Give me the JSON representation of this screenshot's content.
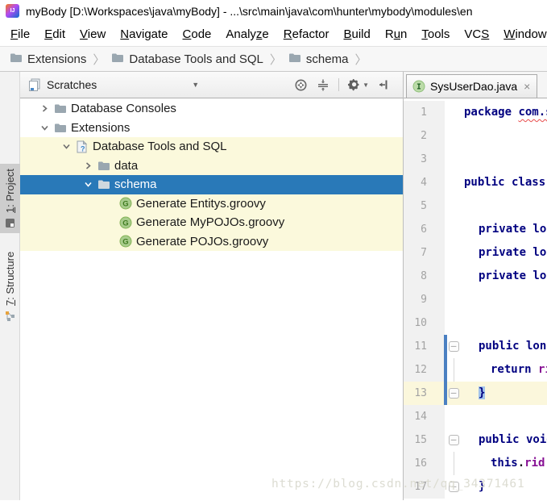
{
  "title_bar": {
    "title": "myBody [D:\\Workspaces\\java\\myBody] - ...\\src\\main\\java\\com\\hunter\\mybody\\modules\\en"
  },
  "menu_bar": {
    "items": [
      {
        "pre": "",
        "key": "F",
        "post": "ile"
      },
      {
        "pre": "",
        "key": "E",
        "post": "dit"
      },
      {
        "pre": "",
        "key": "V",
        "post": "iew"
      },
      {
        "pre": "",
        "key": "N",
        "post": "avigate"
      },
      {
        "pre": "",
        "key": "C",
        "post": "ode"
      },
      {
        "pre": "Analy",
        "key": "z",
        "post": "e"
      },
      {
        "pre": "",
        "key": "R",
        "post": "efactor"
      },
      {
        "pre": "",
        "key": "B",
        "post": "uild"
      },
      {
        "pre": "R",
        "key": "u",
        "post": "n"
      },
      {
        "pre": "",
        "key": "T",
        "post": "ools"
      },
      {
        "pre": "VC",
        "key": "S",
        "post": ""
      },
      {
        "pre": "",
        "key": "W",
        "post": "indow"
      }
    ]
  },
  "breadcrumbs": {
    "items": [
      {
        "label": "Extensions"
      },
      {
        "label": "Database Tools and SQL"
      },
      {
        "label": "schema"
      }
    ]
  },
  "tool_window_bar": {
    "buttons": [
      {
        "pre": "",
        "key": "1",
        "post": ": Project",
        "icon": "project-icon",
        "active": true
      },
      {
        "pre": "",
        "key": "7",
        "post": ": Structure",
        "icon": "structure-icon",
        "active": false
      }
    ]
  },
  "project_panel": {
    "header": {
      "title": "Scratches",
      "icons": [
        "locate-icon",
        "collapse-all-icon",
        "settings-icon",
        "hide-icon"
      ]
    },
    "tree": [
      {
        "label": "Database Consoles",
        "depth": 0,
        "chevron": "collapsed",
        "icon": "folder",
        "bg": "none"
      },
      {
        "label": "Extensions",
        "depth": 0,
        "chevron": "expanded",
        "icon": "folder",
        "bg": "none"
      },
      {
        "label": "Database Tools and SQL",
        "depth": 1,
        "chevron": "expanded",
        "icon": "unknown-file",
        "bg": "yellow"
      },
      {
        "label": "data",
        "depth": 2,
        "chevron": "collapsed",
        "icon": "folder",
        "bg": "yellow"
      },
      {
        "label": "schema",
        "depth": 2,
        "chevron": "expanded",
        "icon": "folder",
        "bg": "selected"
      },
      {
        "label": "Generate Entitys.groovy",
        "depth": 3,
        "chevron": "none",
        "icon": "groovy",
        "bg": "yellow"
      },
      {
        "label": "Generate MyPOJOs.groovy",
        "depth": 3,
        "chevron": "none",
        "icon": "groovy",
        "bg": "yellow"
      },
      {
        "label": "Generate POJOs.groovy",
        "depth": 3,
        "chevron": "none",
        "icon": "groovy",
        "bg": "yellow"
      }
    ]
  },
  "editor": {
    "tab": {
      "title": "SysUserDao.java",
      "icon": "interface-icon",
      "close": "×"
    },
    "lines": [
      {
        "num": 1,
        "indent": 0,
        "segments": [
          {
            "t": "package ",
            "c": "kw"
          },
          {
            "t": "com.s",
            "c": "err"
          }
        ]
      },
      {
        "num": 2,
        "indent": 0,
        "segments": []
      },
      {
        "num": 3,
        "indent": 0,
        "segments": []
      },
      {
        "num": 4,
        "indent": 0,
        "segments": [
          {
            "t": "public class ",
            "c": "kw"
          }
        ]
      },
      {
        "num": 5,
        "indent": 0,
        "segments": []
      },
      {
        "num": 6,
        "indent": 1,
        "segments": [
          {
            "t": "private lon",
            "c": "kw"
          }
        ]
      },
      {
        "num": 7,
        "indent": 1,
        "segments": [
          {
            "t": "private lon",
            "c": "kw"
          }
        ]
      },
      {
        "num": 8,
        "indent": 1,
        "segments": [
          {
            "t": "private lon",
            "c": "kw"
          }
        ]
      },
      {
        "num": 9,
        "indent": 0,
        "segments": []
      },
      {
        "num": 10,
        "indent": 0,
        "segments": []
      },
      {
        "num": 11,
        "indent": 1,
        "fold": "start",
        "vcs": true,
        "segments": [
          {
            "t": "public long",
            "c": "kw"
          }
        ]
      },
      {
        "num": 12,
        "indent": 2,
        "foldline": true,
        "vcs": true,
        "segments": [
          {
            "t": "return ",
            "c": "kw"
          },
          {
            "t": "ri",
            "c": "field"
          }
        ]
      },
      {
        "num": 13,
        "indent": 1,
        "fold": "end",
        "vcs": true,
        "current": true,
        "segments": [
          {
            "t": "}",
            "c": "kw",
            "sel": true
          }
        ]
      },
      {
        "num": 14,
        "indent": 0,
        "segments": []
      },
      {
        "num": 15,
        "indent": 1,
        "fold": "start",
        "segments": [
          {
            "t": "public void",
            "c": "kw"
          }
        ]
      },
      {
        "num": 16,
        "indent": 2,
        "foldline": true,
        "segments": [
          {
            "t": "this",
            "c": "kw"
          },
          {
            "t": ".",
            "c": "plain"
          },
          {
            "t": "rid",
            "c": "field"
          }
        ]
      },
      {
        "num": 17,
        "indent": 1,
        "fold": "end",
        "segments": [
          {
            "t": "}",
            "c": "kw"
          }
        ]
      }
    ]
  },
  "watermark": {
    "text": "https://blog.csdn.net/qq_34371461"
  },
  "colors": {
    "selection-blue": "#2979b8",
    "tree-yellow": "#fbf9dc",
    "current-line": "#fbf7dc",
    "keyword-navy": "#000080",
    "field-purple": "#871094",
    "error-red": "#e84c4c",
    "vcs-blue": "#4b80c2",
    "selection-code": "#a2c3eb",
    "groovy-green": "#a8cc8c",
    "interface-green": "#bbdba8"
  }
}
